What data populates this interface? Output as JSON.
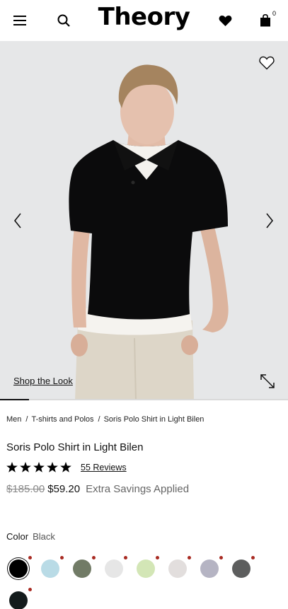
{
  "header": {
    "logo": "Theory",
    "menu_icon": "hamburger-menu-icon",
    "search_icon": "search-icon",
    "wishlist_icon": "heart-icon",
    "bag_icon": "shopping-bag-icon",
    "bag_count": "0"
  },
  "hero": {
    "shop_the_look": "Shop the Look",
    "progress": 0.1,
    "icons": [
      "chevron-left-icon",
      "chevron-right-icon",
      "heart-outline-icon",
      "expand-icon"
    ]
  },
  "breadcrumb": {
    "items": [
      "Men",
      "T-shirts and Polos",
      "Soris Polo Shirt in Light Bilen"
    ]
  },
  "product": {
    "title": "Soris Polo Shirt in Light Bilen",
    "rating": 5,
    "reviews": "55 Reviews",
    "original_price": "$185.00",
    "sale_price": "$59.20",
    "savings_note": "Extra Savings Applied",
    "color_label": "Color",
    "color_value": "Black"
  },
  "swatches": [
    {
      "color": "#000000",
      "selected": true
    },
    {
      "color": "#b9dbe6",
      "selected": false
    },
    {
      "color": "#717b66",
      "selected": false
    },
    {
      "color": "#e6e6e6",
      "selected": false
    },
    {
      "color": "#d3e6b6",
      "selected": false
    },
    {
      "color": "#e2dedd",
      "selected": false
    },
    {
      "color": "#b5b4c3",
      "selected": false
    },
    {
      "color": "#5d5e5e",
      "selected": false
    },
    {
      "color": "#131b1c",
      "selected": false
    }
  ],
  "colors": {
    "sale_dot": "#a82a22",
    "text": "#111111",
    "muted": "#8a8a8a"
  }
}
